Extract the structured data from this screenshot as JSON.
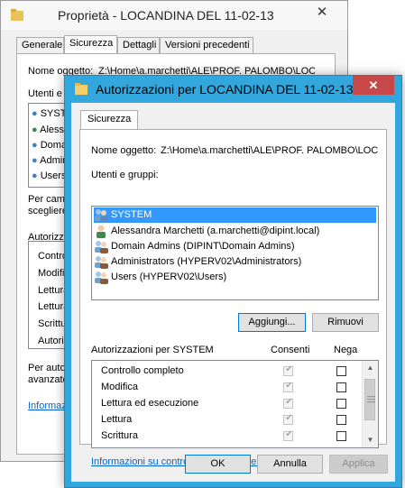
{
  "background_window": {
    "title": "Proprietà - LOCANDINA DEL 11-02-13",
    "close_glyph": "✕",
    "tabs": [
      {
        "label": "Generale",
        "active": false
      },
      {
        "label": "Sicurezza",
        "active": true
      },
      {
        "label": "Dettagli",
        "active": false
      },
      {
        "label": "Versioni precedenti",
        "active": false
      }
    ],
    "object_name_label": "Nome oggetto:",
    "object_name_value": "Z:\\Home\\a.marchetti\\ALE\\PROF. PALOMBO\\LOC",
    "users_label": "Utenti e gruppi:",
    "users": [
      "SYSTEM",
      "Alessandra Marchetti",
      "Domain Admins",
      "Administrators",
      "Users"
    ],
    "change_text_1": "Per cambiare le autorizzazioni, fare clic su Modifica.",
    "change_text_2": "scegliere",
    "permissions_label": "Autorizzazioni",
    "permissions": [
      "Controllo completo",
      "Modifica",
      "Lettura ed esecuzione",
      "Lettura",
      "Scrittura",
      "Autorizzazioni speciali"
    ],
    "advanced_text_1": "Per autorizzazioni speciali o impostazioni",
    "advanced_text_2": "avanzate",
    "info_link": "Informazioni su controllo di accesso e autorizzazioni"
  },
  "dialog": {
    "title": "Autorizzazioni per LOCANDINA DEL 11-02-13",
    "close_glyph": "✕",
    "tab_label": "Sicurezza",
    "object_name_label": "Nome oggetto:",
    "object_name_value": "Z:\\Home\\a.marchetti\\ALE\\PROF. PALOMBO\\LOC",
    "users_label": "Utenti e gruppi:",
    "users": [
      {
        "name": "SYSTEM",
        "selected": true,
        "icon": "group-icon"
      },
      {
        "name": "Alessandra Marchetti (a.marchetti@dipint.local)",
        "selected": false,
        "icon": "user-icon"
      },
      {
        "name": "Domain Admins (DIPINT\\Domain Admins)",
        "selected": false,
        "icon": "group-icon"
      },
      {
        "name": "Administrators (HYPERV02\\Administrators)",
        "selected": false,
        "icon": "group-icon"
      },
      {
        "name": "Users (HYPERV02\\Users)",
        "selected": false,
        "icon": "group-icon"
      }
    ],
    "add_button": "Aggiungi...",
    "remove_button": "Rimuovi",
    "permissions_for": "Autorizzazioni per SYSTEM",
    "allow_header": "Consenti",
    "deny_header": "Nega",
    "permissions": [
      {
        "name": "Controllo completo",
        "allow": true,
        "deny": false
      },
      {
        "name": "Modifica",
        "allow": true,
        "deny": false
      },
      {
        "name": "Lettura ed esecuzione",
        "allow": true,
        "deny": false
      },
      {
        "name": "Lettura",
        "allow": true,
        "deny": false
      },
      {
        "name": "Scrittura",
        "allow": true,
        "deny": false
      }
    ],
    "info_link": "Informazioni su controllo di accesso e autorizzazioni",
    "ok_button": "OK",
    "cancel_button": "Annulla",
    "apply_button": "Applica",
    "colors": {
      "titlebar": "#32a7dd",
      "close": "#c74848",
      "selection": "#3399ff",
      "link": "#0066cc"
    }
  }
}
